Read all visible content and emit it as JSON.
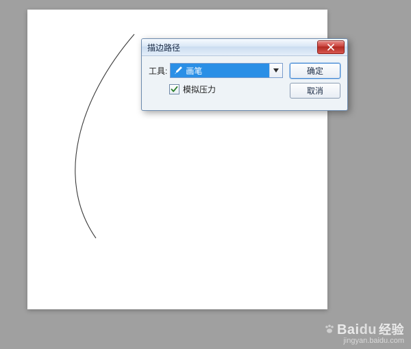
{
  "dialog": {
    "title": "描边路径",
    "tool_label": "工具:",
    "tool_selected": "画笔",
    "simulate_pressure_label": "模拟压力",
    "simulate_pressure_checked": true,
    "ok_label": "确定",
    "cancel_label": "取消"
  },
  "watermark": {
    "brand_prefix": "Bai",
    "brand_suffix": "du",
    "brand_cn": "经验",
    "url": "jingyan.baidu.com"
  }
}
